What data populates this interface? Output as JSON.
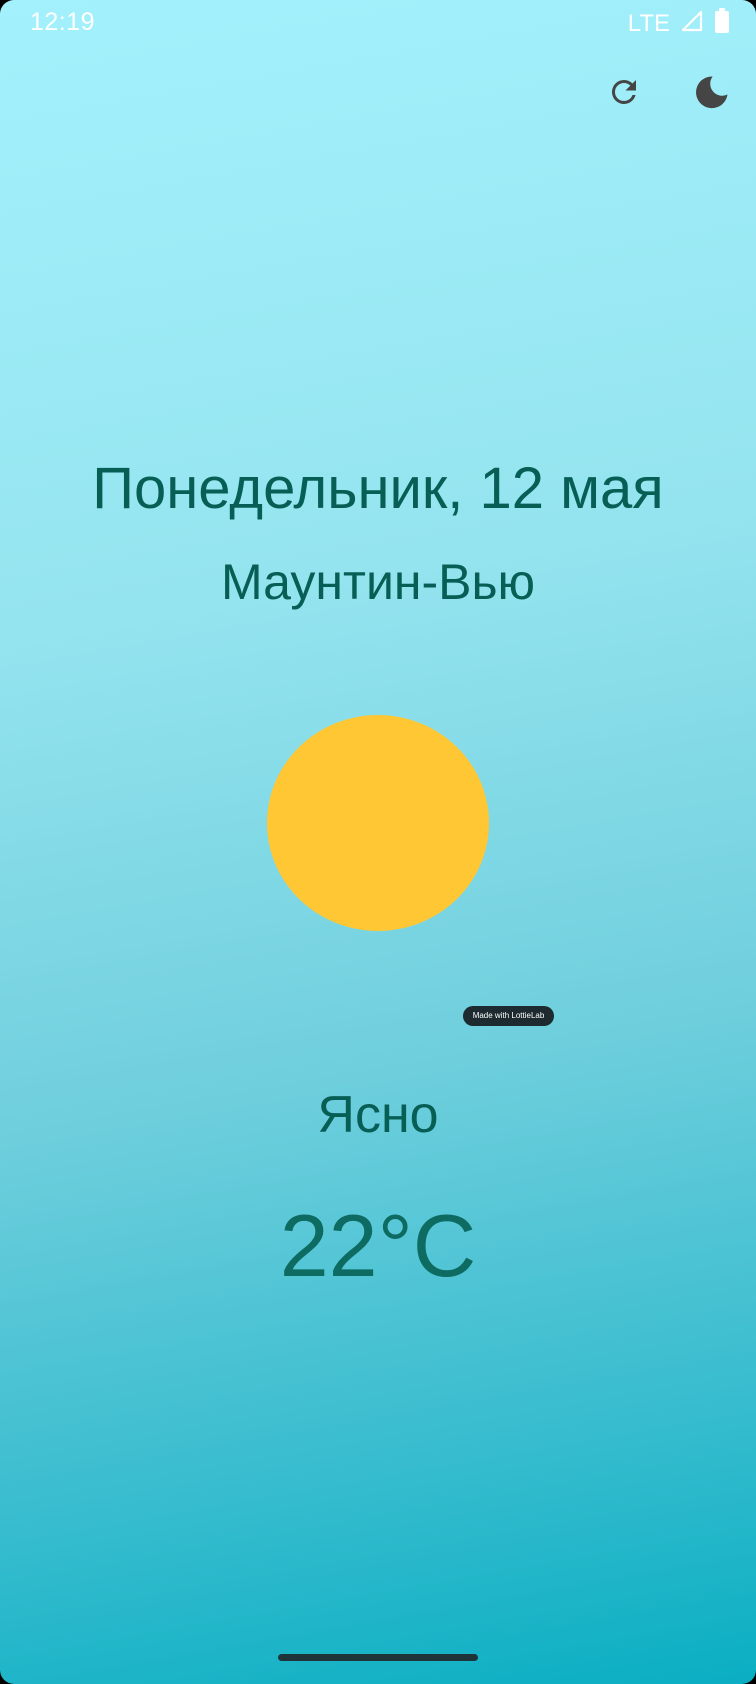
{
  "status_bar": {
    "time": "12:19",
    "network": "LTE",
    "icons": [
      "signal-icon",
      "battery-icon"
    ]
  },
  "actions": {
    "refresh_icon": "refresh-icon",
    "theme_icon": "moon-icon"
  },
  "weather": {
    "date": "Понедельник, 12 мая",
    "city": "Маунтин-Вью",
    "condition": "Ясно",
    "temperature": "22°C",
    "animation_badge": "Made with LottieLab",
    "sun_color": "#ffc733"
  },
  "colors": {
    "text_primary": "#075e55",
    "background_top": "#a3f1fc",
    "background_bottom": "#0aaec2"
  }
}
